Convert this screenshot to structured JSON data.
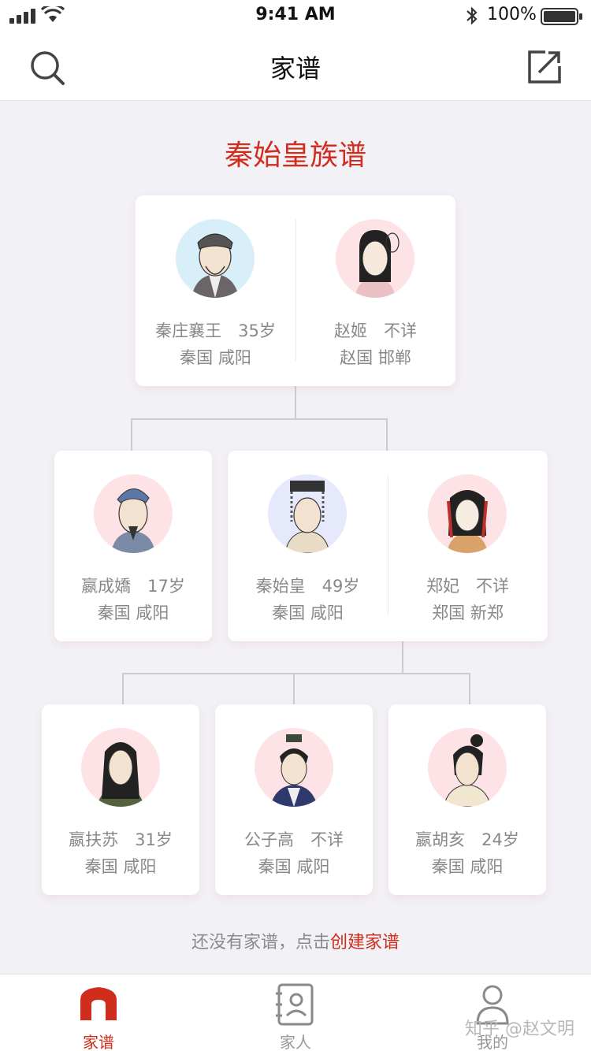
{
  "status": {
    "time": "9:41 AM",
    "battery": "100%"
  },
  "nav": {
    "title": "家谱"
  },
  "tree": {
    "title": "秦始皇族谱",
    "gen1": [
      {
        "line1": "秦庄襄王　35岁",
        "line2": "秦国 咸阳",
        "avatar_bg": "#d8eef9"
      },
      {
        "line1": "赵姬　不详",
        "line2": "赵国 邯郸",
        "avatar_bg": "#fde3e6"
      }
    ],
    "gen2_single": {
      "line1": "嬴成嬌　17岁",
      "line2": "秦国 咸阳",
      "avatar_bg": "#fde3e6"
    },
    "gen2_couple": [
      {
        "line1": "秦始皇　49岁",
        "line2": "秦国 咸阳",
        "avatar_bg": "#e6e8fb"
      },
      {
        "line1": "郑妃　不详",
        "line2": "郑国 新郑",
        "avatar_bg": "#fde3e6"
      }
    ],
    "gen3": [
      {
        "line1": "嬴扶苏　31岁",
        "line2": "秦国 咸阳",
        "avatar_bg": "#fde3e6"
      },
      {
        "line1": "公子高　不详",
        "line2": "秦国 咸阳",
        "avatar_bg": "#fde3e6"
      },
      {
        "line1": "嬴胡亥　24岁",
        "line2": "秦国 咸阳",
        "avatar_bg": "#fde3e6"
      }
    ]
  },
  "footer": {
    "prefix": "还没有家谱，点击",
    "link": "创建家谱"
  },
  "tabs": [
    {
      "label": "家谱",
      "icon": "home-icon",
      "active": true
    },
    {
      "label": "家人",
      "icon": "contacts-icon",
      "active": false
    },
    {
      "label": "我的",
      "icon": "profile-icon",
      "active": false
    }
  ],
  "watermark": "知乎 @赵文明",
  "colors": {
    "accent": "#d02d1e",
    "background": "#f2f1f6"
  }
}
